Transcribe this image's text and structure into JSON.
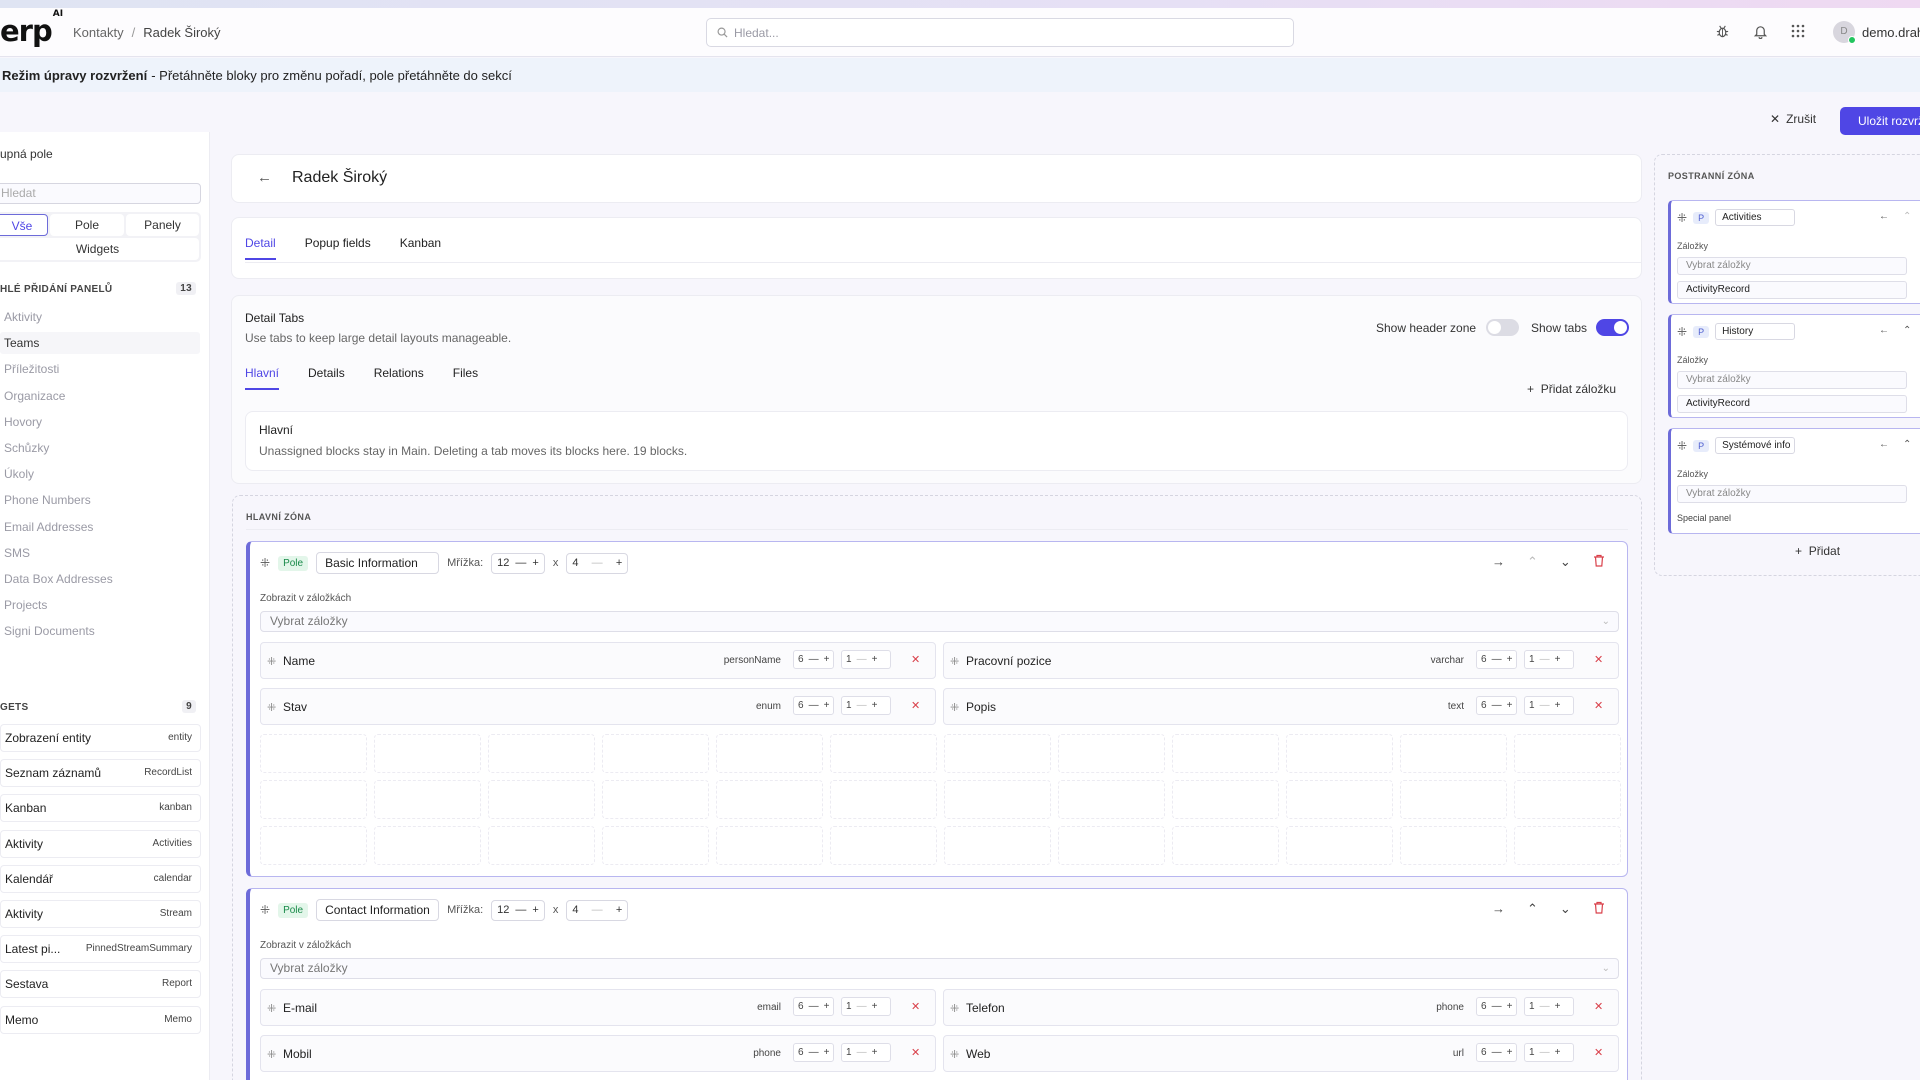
{
  "topbar": {
    "logo": "erp",
    "logo_sup": "AI",
    "breadcrumb": [
      "Kontakty",
      "Radek Široký"
    ],
    "search_placeholder": "Hledat...",
    "user_initial": "D",
    "user_name": "demo.drahv"
  },
  "edit_mode": {
    "bold": "Režim úpravy rozvržení",
    "text": "- Přetáhněte bloky pro změnu pořadí, pole přetáhněte do sekcí",
    "cancel": "Zrušit",
    "save": "Uložit rozvržení"
  },
  "left_panel": {
    "title": "upná pole",
    "search_placeholder": "Hledat",
    "filters": [
      "Vše",
      "Pole",
      "Panely",
      "Widgets"
    ],
    "panels_section": {
      "title": "HLÉ PŘIDÁNÍ PANELŮ",
      "count": "13"
    },
    "panels": [
      "Aktivity",
      "Teams",
      "Příležitosti",
      "Organizace",
      "Hovory",
      "Schůzky",
      "Úkoly",
      "Phone Numbers",
      "Email Addresses",
      "SMS",
      "Data Box Addresses",
      "Projects",
      "Signi Documents"
    ],
    "widgets_section": {
      "title": "GETS",
      "count": "9"
    },
    "widgets": [
      {
        "label": "Zobrazení entity",
        "tag": "entity"
      },
      {
        "label": "Seznam záznamů",
        "tag": "RecordList"
      },
      {
        "label": "Kanban",
        "tag": "kanban"
      },
      {
        "label": "Aktivity",
        "tag": "Activities"
      },
      {
        "label": "Kalendář",
        "tag": "calendar"
      },
      {
        "label": "Aktivity",
        "tag": "Stream"
      },
      {
        "label": "Latest pi...",
        "tag": "PinnedStreamSummary"
      },
      {
        "label": "Sestava",
        "tag": "Report"
      },
      {
        "label": "Memo",
        "tag": "Memo"
      }
    ]
  },
  "record": {
    "title": "Radek Široký"
  },
  "layout_tabs": [
    "Detail",
    "Popup fields",
    "Kanban"
  ],
  "detail_tabs": {
    "title": "Detail Tabs",
    "subtitle": "Use tabs to keep large detail layouts manageable.",
    "show_header_zone": "Show header zone",
    "show_tabs": "Show tabs",
    "show_header_zone_on": false,
    "show_tabs_on": true,
    "tabs": [
      "Hlavní",
      "Details",
      "Relations",
      "Files"
    ],
    "add_tab": "Přidat záložku",
    "active_title": "Hlavní",
    "active_sub": "Unassigned blocks stay in Main. Deleting a tab moves its blocks here. 19 blocks."
  },
  "main_zone": {
    "label": "HLAVNÍ ZÓNA",
    "blocks": [
      {
        "kind": "Pole",
        "name": "Basic Information",
        "grid_label": "Mřížka:",
        "cols": "12",
        "x": "x",
        "rows": "4",
        "tabs_label": "Zobrazit v záložkách",
        "tabs_placeholder": "Vybrat záložky",
        "fields": [
          {
            "name": "Name",
            "type": "personName",
            "w": "6",
            "h": "1"
          },
          {
            "name": "Pracovní pozice",
            "type": "varchar",
            "w": "6",
            "h": "1"
          },
          {
            "name": "Stav",
            "type": "enum",
            "w": "6",
            "h": "1"
          },
          {
            "name": "Popis",
            "type": "text",
            "w": "6",
            "h": "1"
          }
        ]
      },
      {
        "kind": "Pole",
        "name": "Contact Information",
        "grid_label": "Mřížka:",
        "cols": "12",
        "x": "x",
        "rows": "4",
        "tabs_label": "Zobrazit v záložkách",
        "tabs_placeholder": "Vybrat záložky",
        "fields": [
          {
            "name": "E-mail",
            "type": "email",
            "w": "6",
            "h": "1"
          },
          {
            "name": "Telefon",
            "type": "phone",
            "w": "6",
            "h": "1"
          },
          {
            "name": "Mobil",
            "type": "phone",
            "w": "6",
            "h": "1"
          },
          {
            "name": "Web",
            "type": "url",
            "w": "6",
            "h": "1"
          }
        ]
      }
    ]
  },
  "side_zone": {
    "label": "POSTRANNÍ ZÓNA",
    "blocks": [
      {
        "kind": "P",
        "name": "Activities",
        "tabs_label": "Záložky",
        "tabs_placeholder": "Vybrat záložky",
        "value": "ActivityRecord"
      },
      {
        "kind": "P",
        "name": "History",
        "tabs_label": "Záložky",
        "tabs_placeholder": "Vybrat záložky",
        "value": "ActivityRecord"
      },
      {
        "kind": "P",
        "name": "Systémové info",
        "tabs_label": "Záložky",
        "tabs_placeholder": "Vybrat záložky",
        "value": "Special panel"
      }
    ],
    "add": "Přidat"
  },
  "colors": {
    "accent": "#4f46e5",
    "pole_green": "#188a49",
    "danger": "#d9404a"
  },
  "icons": {
    "search": "search-icon",
    "bug": "bug-icon",
    "bell": "bell-icon",
    "apps": "apps-grid-icon",
    "drag": "drag-handle-icon",
    "trash": "trash-icon"
  }
}
